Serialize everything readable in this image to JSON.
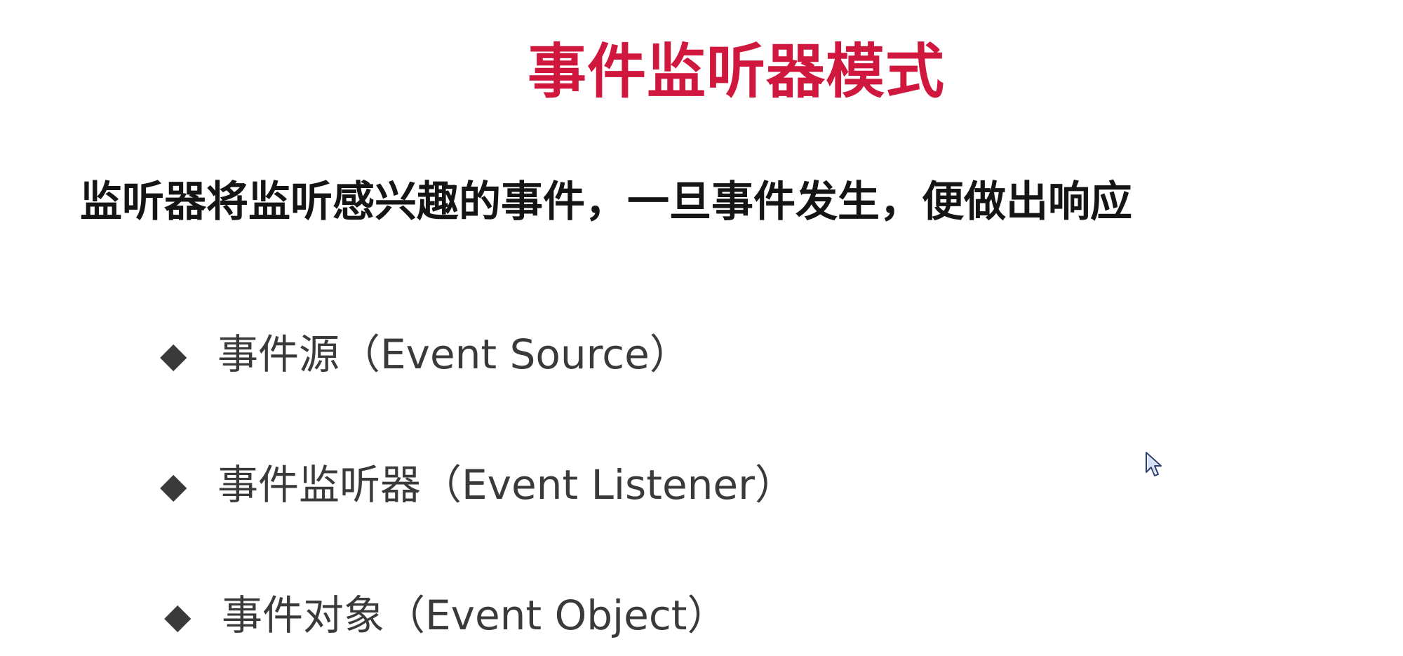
{
  "slide": {
    "title": "事件监听器模式",
    "subtitle": "监听器将监听感兴趣的事件，一旦事件发生，便做出响应",
    "bullets": [
      {
        "marker": "◆",
        "text": "事件源（Event Source）"
      },
      {
        "marker": "◆",
        "text": "事件监听器（Event Listener）"
      },
      {
        "marker": "◆",
        "text": "事件对象（Event Object）"
      }
    ]
  },
  "colors": {
    "title": "#d0183f",
    "subtitle": "#151515",
    "bullet_text": "#3a3a3a",
    "background": "#ffffff"
  },
  "icons": {
    "cursor": "mouse-pointer-icon",
    "bullet": "diamond-bullet-icon"
  }
}
